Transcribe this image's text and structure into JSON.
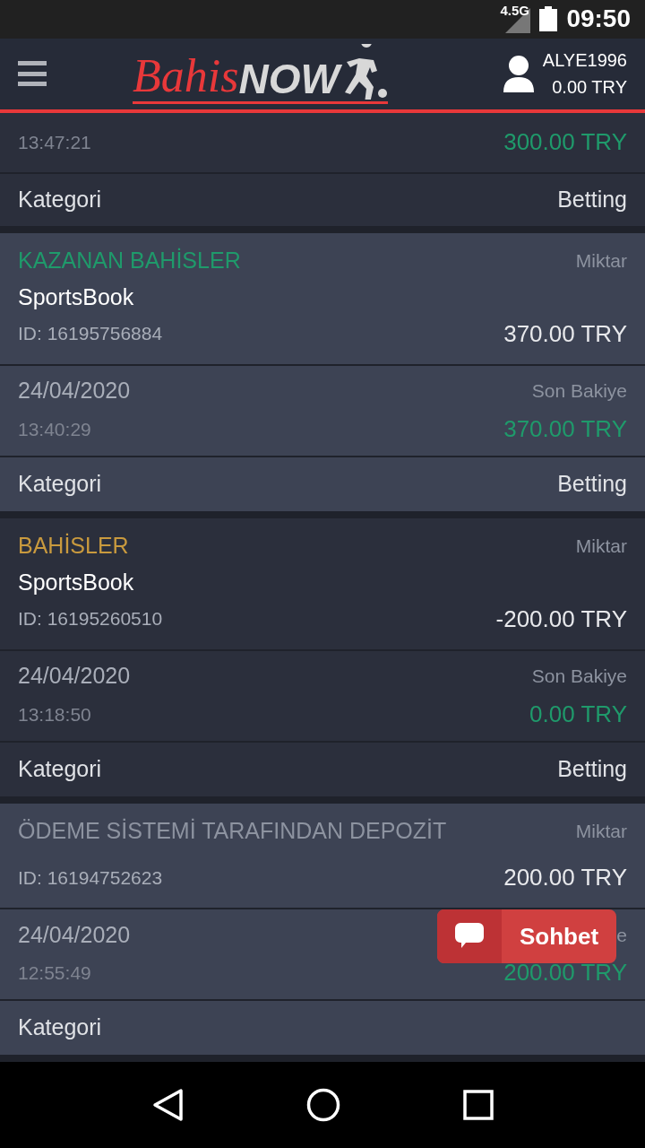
{
  "status_bar": {
    "network": "4.5G",
    "time": "09:50"
  },
  "header": {
    "logo": {
      "script": "Bahis",
      "bold": "NOW"
    },
    "user": {
      "name": "ALYE1996",
      "balance": "0.00 TRY"
    }
  },
  "partial_entry": {
    "time": "13:47:21",
    "balance": "300.00 TRY",
    "category_label": "Kategori",
    "category": "Betting"
  },
  "entries": [
    {
      "kind": "win",
      "title": "KAZANAN BAHİSLER",
      "provider": "SportsBook",
      "id": "ID: 16195756884",
      "amount_label": "Miktar",
      "amount": "370.00 TRY",
      "date": "24/04/2020",
      "time": "13:40:29",
      "balance_label": "Son Bakiye",
      "balance": "370.00 TRY",
      "category_label": "Kategori",
      "category": "Betting"
    },
    {
      "kind": "bet",
      "title": "BAHİSLER",
      "provider": "SportsBook",
      "id": "ID: 16195260510",
      "amount_label": "Miktar",
      "amount": "-200.00 TRY",
      "date": "24/04/2020",
      "time": "13:18:50",
      "balance_label": "Son Bakiye",
      "balance": "0.00 TRY",
      "category_label": "Kategori",
      "category": "Betting"
    },
    {
      "kind": "deposit",
      "title": "ÖDEME SİSTEMİ TARAFINDAN DEPOZİT",
      "id": "ID: 16194752623",
      "amount_label": "Miktar",
      "amount": "200.00 TRY",
      "date": "24/04/2020",
      "time": "12:55:49",
      "balance_label": "e",
      "balance": "200.00 TRY",
      "category_label": "Kategori"
    }
  ],
  "chat_button": {
    "label": "Sohbet"
  }
}
